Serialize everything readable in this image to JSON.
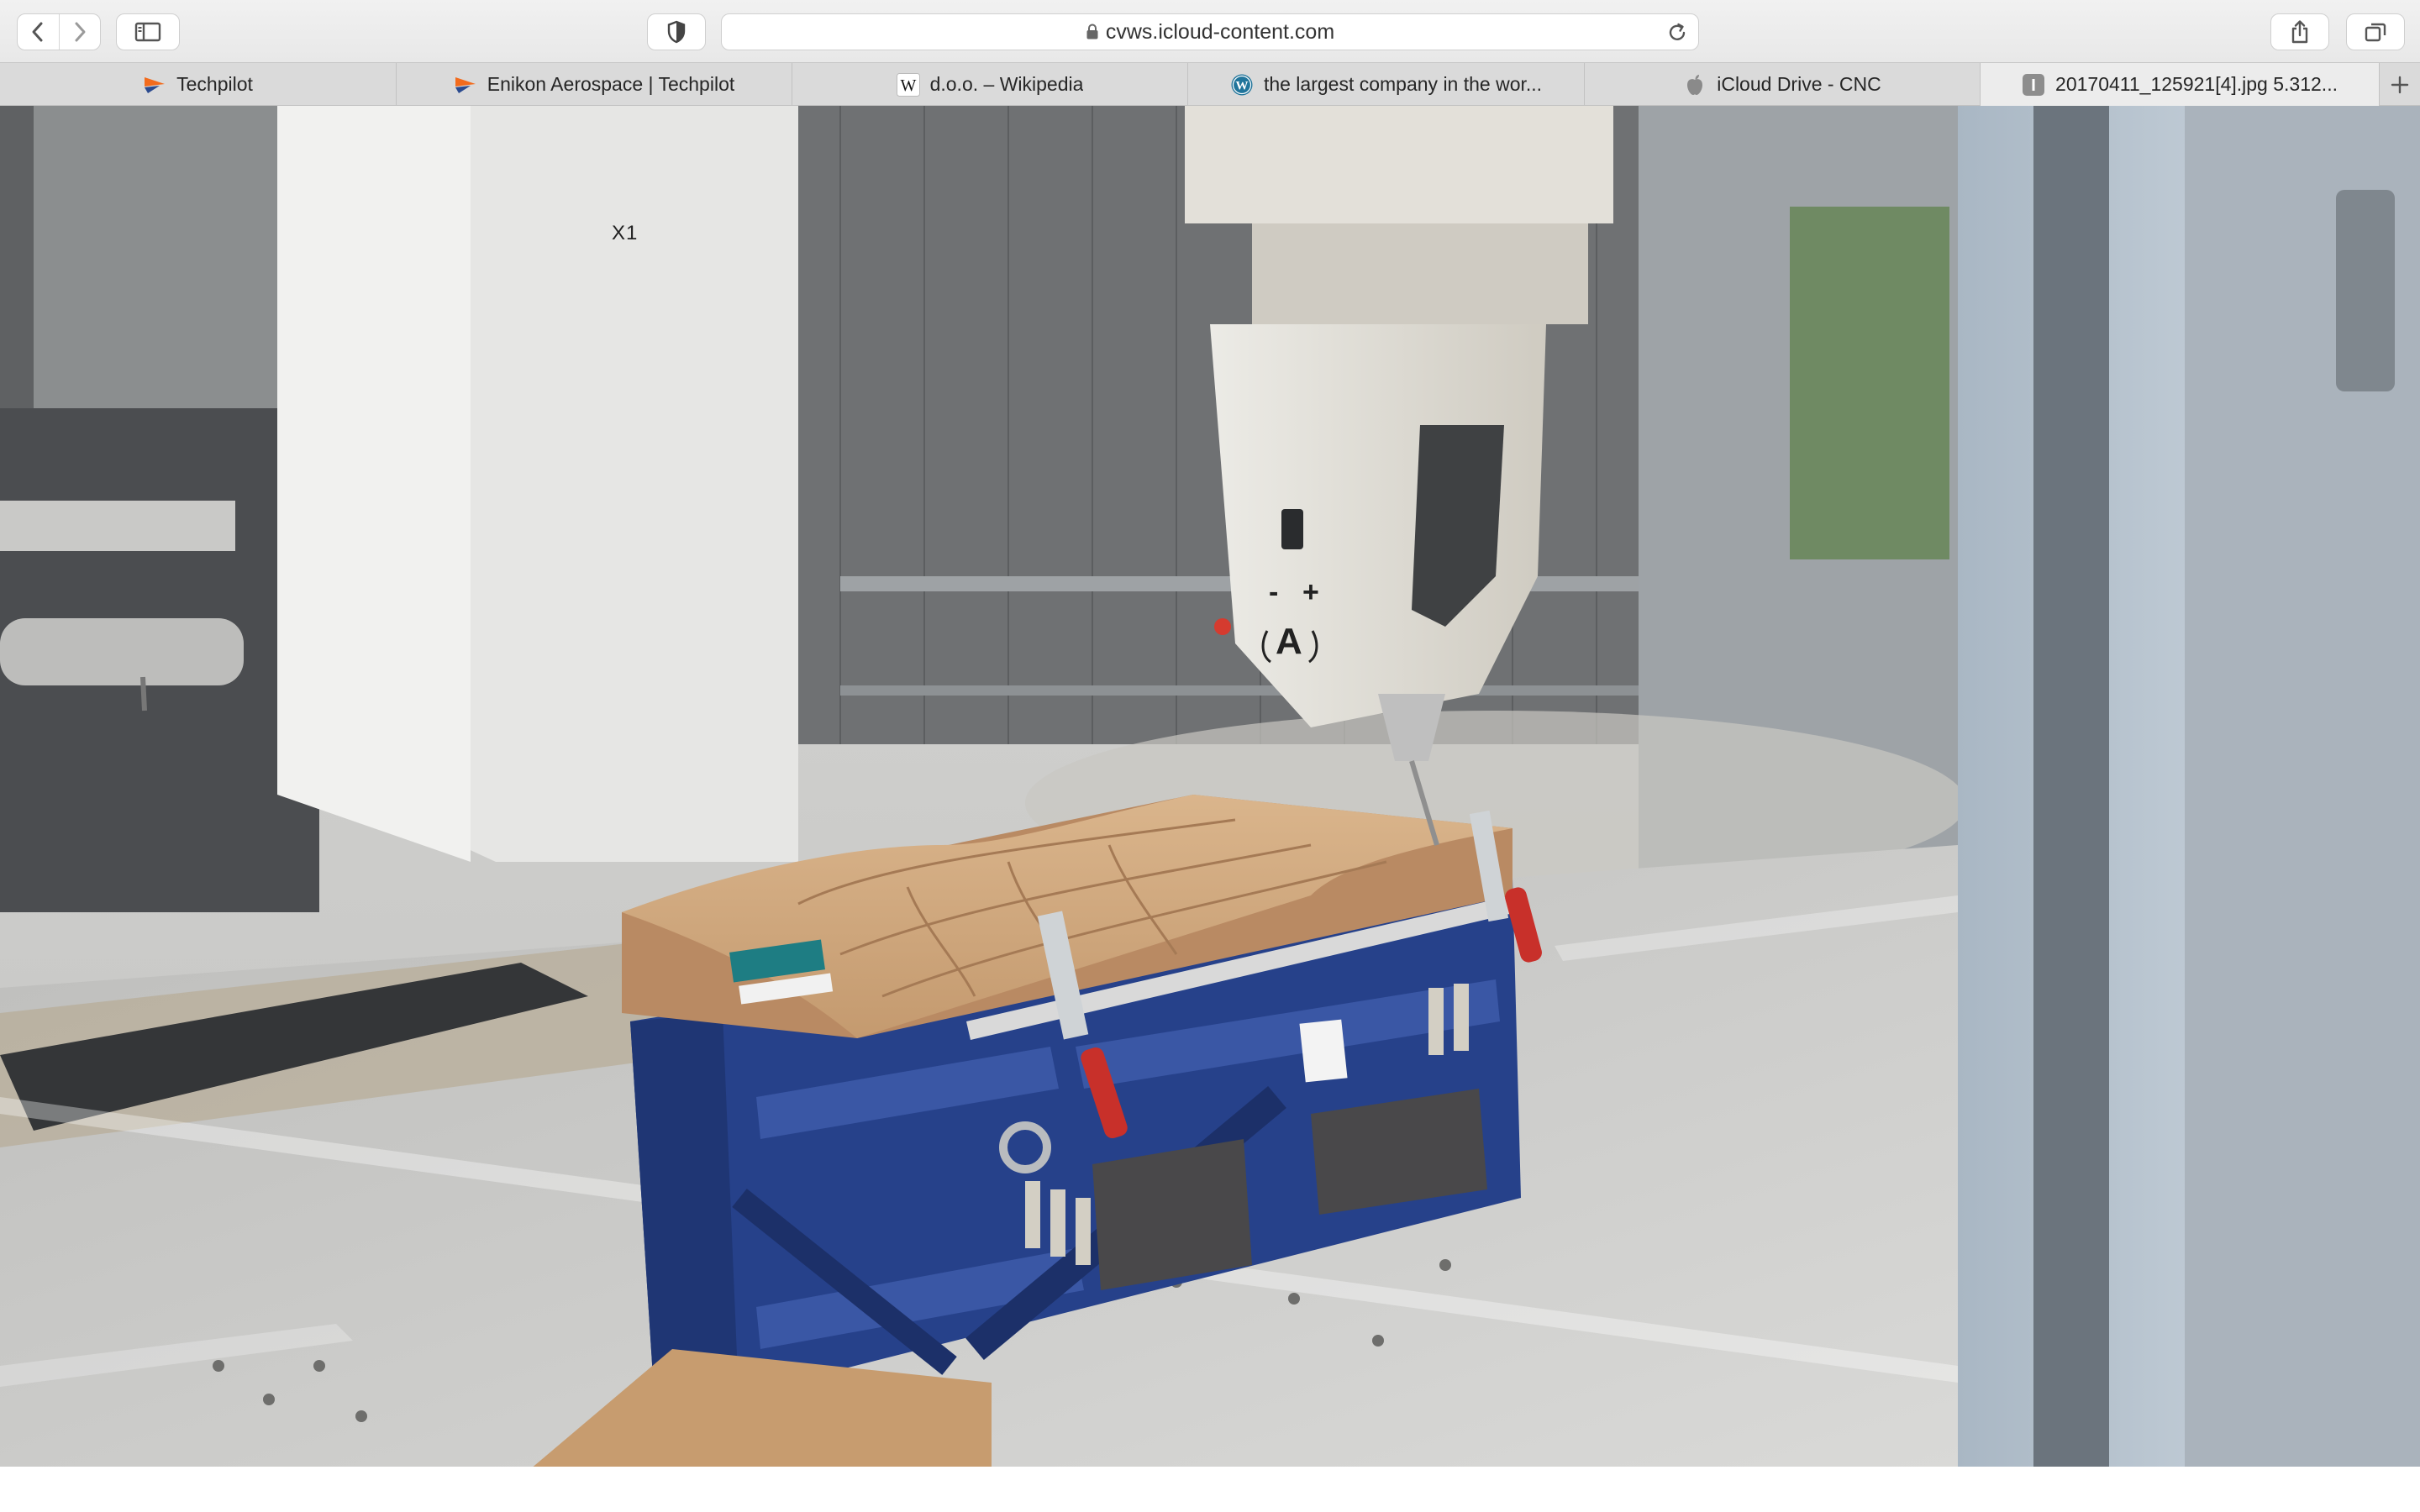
{
  "toolbar": {
    "url": "cvws.icloud-content.com"
  },
  "tabs": [
    {
      "label": "Techpilot",
      "icon": "techpilot-icon"
    },
    {
      "label": "Enikon Aerospace | Techpilot",
      "icon": "techpilot-icon"
    },
    {
      "label": "d.o.o. – Wikipedia",
      "icon": "wikipedia-icon"
    },
    {
      "label": "the largest company in the wor...",
      "icon": "wordpress-icon"
    },
    {
      "label": "iCloud Drive - CNC",
      "icon": "apple-icon"
    },
    {
      "label": "20170411_125921[4].jpg 5.312...",
      "icon": "image-icon",
      "active": true
    }
  ],
  "photo": {
    "marking": "X1",
    "head_label": "A",
    "head_minus": "-",
    "head_plus": "+"
  },
  "colors": {
    "accent_techpilot": "#f26b1d",
    "fixture_blue": "#26418a",
    "wood": "#cba17a",
    "machine_head": "#e6e2d9"
  }
}
